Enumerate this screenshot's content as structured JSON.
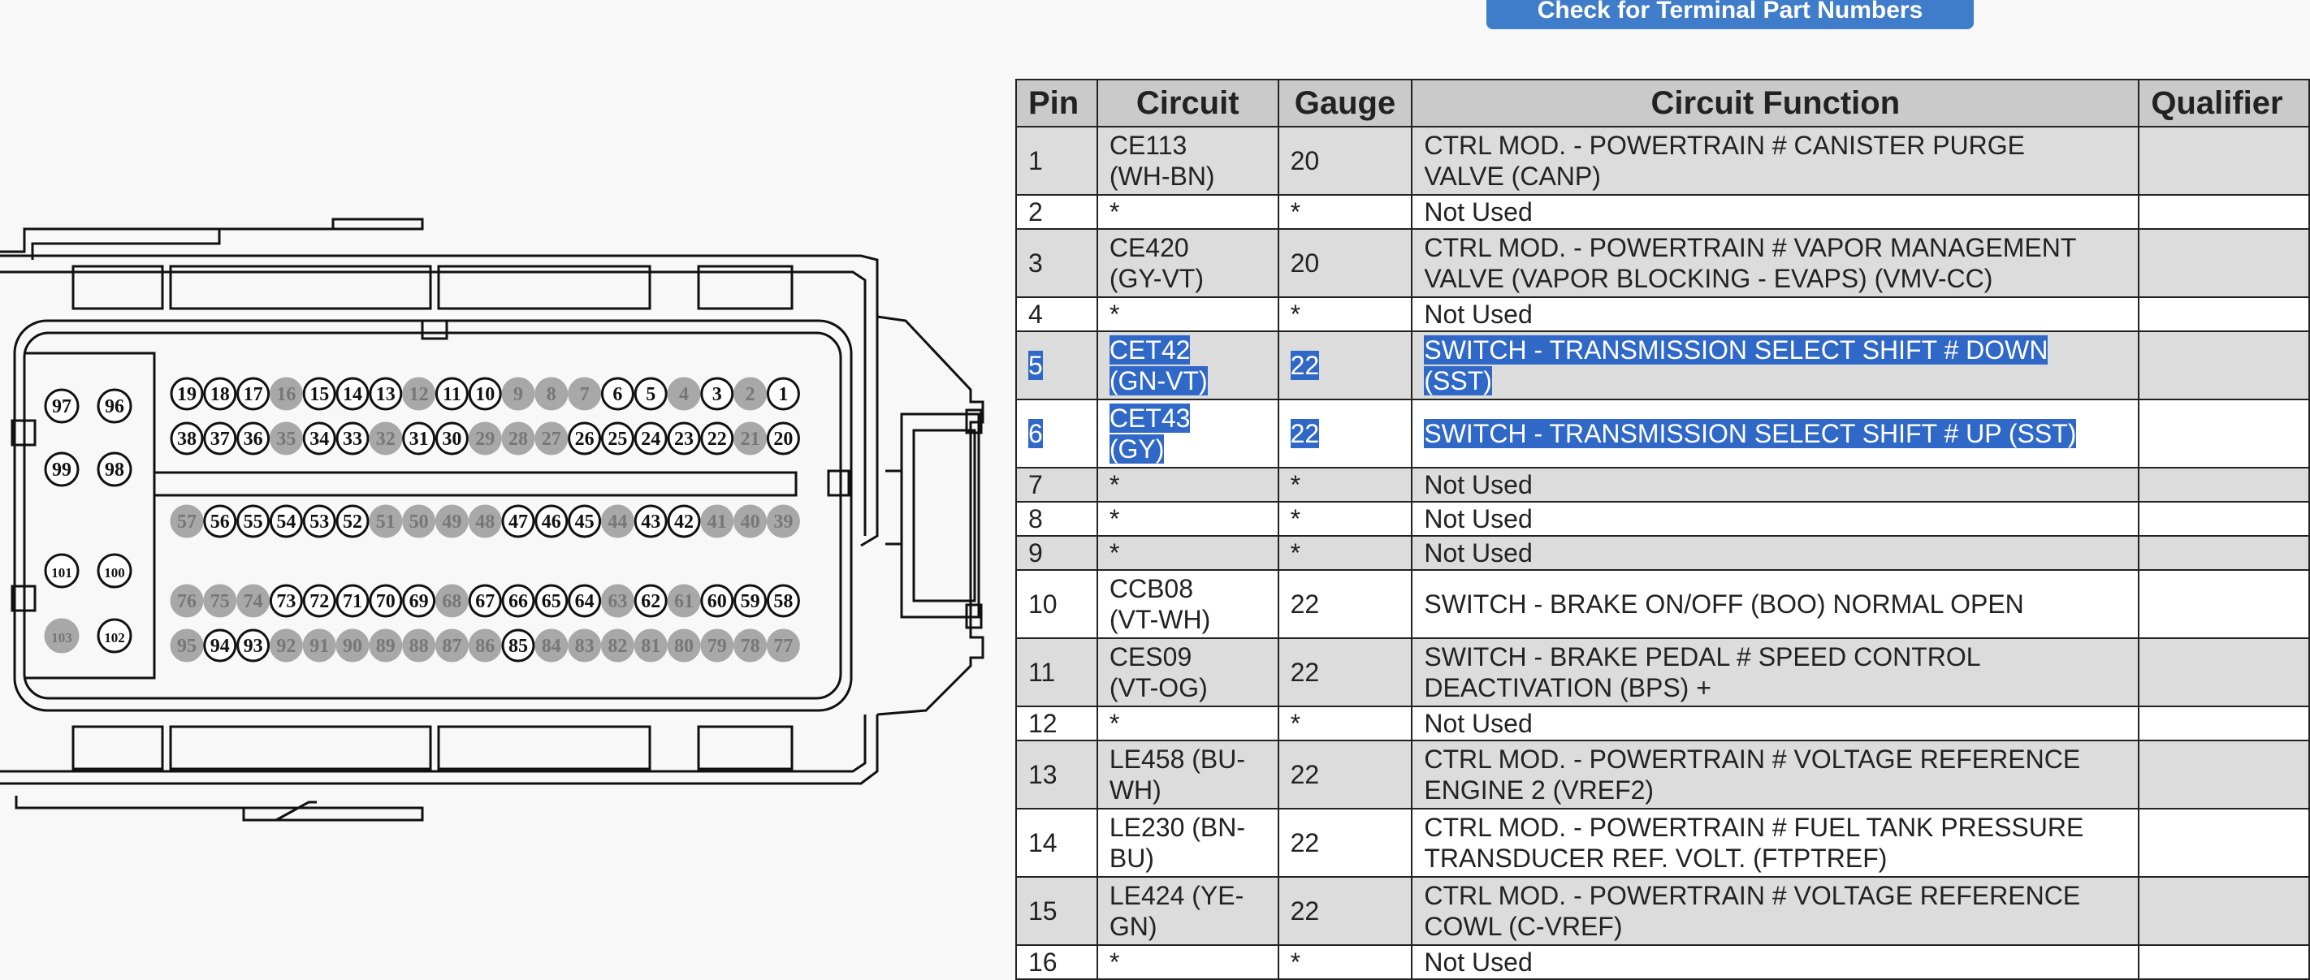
{
  "top_button": {
    "label": "Check for Terminal Part Numbers"
  },
  "table": {
    "headers": [
      "Pin",
      "Circuit",
      "Gauge",
      "Circuit Function",
      "Qualifier"
    ],
    "rows": [
      {
        "pin": "1",
        "circuit": [
          "CE113",
          "(WH-BN)"
        ],
        "gauge": "20",
        "function": [
          "CTRL MOD. - POWERTRAIN # CANISTER PURGE",
          "VALVE (CANP)"
        ],
        "qualifier": "",
        "selected": false
      },
      {
        "pin": "2",
        "circuit": [
          "*"
        ],
        "gauge": "*",
        "function": [
          "Not Used"
        ],
        "qualifier": "",
        "selected": false
      },
      {
        "pin": "3",
        "circuit": [
          "CE420",
          "(GY-VT)"
        ],
        "gauge": "20",
        "function": [
          "CTRL MOD. - POWERTRAIN # VAPOR MANAGEMENT",
          "VALVE (VAPOR BLOCKING - EVAPS) (VMV-CC)"
        ],
        "qualifier": "",
        "selected": false
      },
      {
        "pin": "4",
        "circuit": [
          "*"
        ],
        "gauge": "*",
        "function": [
          "Not Used"
        ],
        "qualifier": "",
        "selected": false
      },
      {
        "pin": "5",
        "circuit": [
          "CET42",
          "(GN-VT)"
        ],
        "gauge": "22",
        "function": [
          "SWITCH - TRANSMISSION SELECT SHIFT # DOWN",
          "(SST)"
        ],
        "qualifier": "",
        "selected": true
      },
      {
        "pin": "6",
        "circuit": [
          "CET43",
          "(GY)"
        ],
        "gauge": "22",
        "function": [
          "SWITCH - TRANSMISSION SELECT SHIFT # UP (SST)"
        ],
        "qualifier": "",
        "selected": true
      },
      {
        "pin": "7",
        "circuit": [
          "*"
        ],
        "gauge": "*",
        "function": [
          "Not Used"
        ],
        "qualifier": "",
        "selected": false
      },
      {
        "pin": "8",
        "circuit": [
          "*"
        ],
        "gauge": "*",
        "function": [
          "Not Used"
        ],
        "qualifier": "",
        "selected": false
      },
      {
        "pin": "9",
        "circuit": [
          "*"
        ],
        "gauge": "*",
        "function": [
          "Not Used"
        ],
        "qualifier": "",
        "selected": false
      },
      {
        "pin": "10",
        "circuit": [
          "CCB08",
          "(VT-WH)"
        ],
        "gauge": "22",
        "function": [
          "SWITCH - BRAKE ON/OFF (BOO) NORMAL OPEN"
        ],
        "qualifier": "",
        "selected": false
      },
      {
        "pin": "11",
        "circuit": [
          "CES09",
          "(VT-OG)"
        ],
        "gauge": "22",
        "function": [
          "SWITCH - BRAKE PEDAL # SPEED CONTROL",
          "DEACTIVATION (BPS) +"
        ],
        "qualifier": "",
        "selected": false
      },
      {
        "pin": "12",
        "circuit": [
          "*"
        ],
        "gauge": "*",
        "function": [
          "Not Used"
        ],
        "qualifier": "",
        "selected": false
      },
      {
        "pin": "13",
        "circuit": [
          "LE458 (BU-",
          "WH)"
        ],
        "gauge": "22",
        "function": [
          "CTRL MOD. - POWERTRAIN # VOLTAGE REFERENCE",
          "ENGINE 2 (VREF2)"
        ],
        "qualifier": "",
        "selected": false
      },
      {
        "pin": "14",
        "circuit": [
          "LE230 (BN-",
          "BU)"
        ],
        "gauge": "22",
        "function": [
          "CTRL MOD. - POWERTRAIN # FUEL TANK PRESSURE",
          "TRANSDUCER REF. VOLT. (FTPTREF)"
        ],
        "qualifier": "",
        "selected": false
      },
      {
        "pin": "15",
        "circuit": [
          "LE424 (YE-",
          "GN)"
        ],
        "gauge": "22",
        "function": [
          "CTRL MOD. - POWERTRAIN # VOLTAGE REFERENCE",
          "COWL (C-VREF)"
        ],
        "qualifier": "",
        "selected": false
      },
      {
        "pin": "16",
        "circuit": [
          "*"
        ],
        "gauge": "*",
        "function": [
          "Not Used"
        ],
        "qualifier": "",
        "selected": false
      }
    ]
  },
  "connector": {
    "grid_rows": [
      {
        "pins": [
          "19",
          "18",
          "17",
          "16",
          "15",
          "14",
          "13",
          "12",
          "11",
          "10",
          "9",
          "8",
          "7",
          "6",
          "5",
          "4",
          "3",
          "2",
          "1"
        ],
        "used": [
          "19",
          "18",
          "17",
          "15",
          "14",
          "13",
          "11",
          "10",
          "6",
          "5",
          "3",
          "1"
        ]
      },
      {
        "pins": [
          "38",
          "37",
          "36",
          "35",
          "34",
          "33",
          "32",
          "31",
          "30",
          "29",
          "28",
          "27",
          "26",
          "25",
          "24",
          "23",
          "22",
          "21",
          "20"
        ],
        "used": [
          "38",
          "37",
          "36",
          "34",
          "33",
          "31",
          "30",
          "26",
          "25",
          "24",
          "23",
          "22",
          "20"
        ]
      },
      {
        "pins": [
          "57",
          "56",
          "55",
          "54",
          "53",
          "52",
          "51",
          "50",
          "49",
          "48",
          "47",
          "46",
          "45",
          "44",
          "43",
          "42",
          "41",
          "40",
          "39"
        ],
        "used": [
          "56",
          "55",
          "54",
          "53",
          "52",
          "47",
          "46",
          "45",
          "43",
          "42"
        ]
      },
      {
        "pins": [
          "76",
          "75",
          "74",
          "73",
          "72",
          "71",
          "70",
          "69",
          "68",
          "67",
          "66",
          "65",
          "64",
          "63",
          "62",
          "61",
          "60",
          "59",
          "58"
        ],
        "used": [
          "73",
          "72",
          "71",
          "70",
          "69",
          "67",
          "66",
          "65",
          "64",
          "62",
          "60",
          "59",
          "58"
        ]
      },
      {
        "pins": [
          "95",
          "94",
          "93",
          "92",
          "91",
          "90",
          "89",
          "88",
          "87",
          "86",
          "85",
          "84",
          "83",
          "82",
          "81",
          "80",
          "79",
          "78",
          "77"
        ],
        "used": [
          "94",
          "93",
          "85"
        ]
      }
    ],
    "side_pins": [
      {
        "pins": [
          "97",
          "96"
        ],
        "used": [
          "97",
          "96"
        ]
      },
      {
        "pins": [
          "99",
          "98"
        ],
        "used": [
          "99",
          "98"
        ]
      },
      {
        "pins": [
          "101",
          "100"
        ],
        "used": [
          "101",
          "100"
        ]
      },
      {
        "pins": [
          "103",
          "102"
        ],
        "used": [
          "102"
        ]
      }
    ]
  }
}
